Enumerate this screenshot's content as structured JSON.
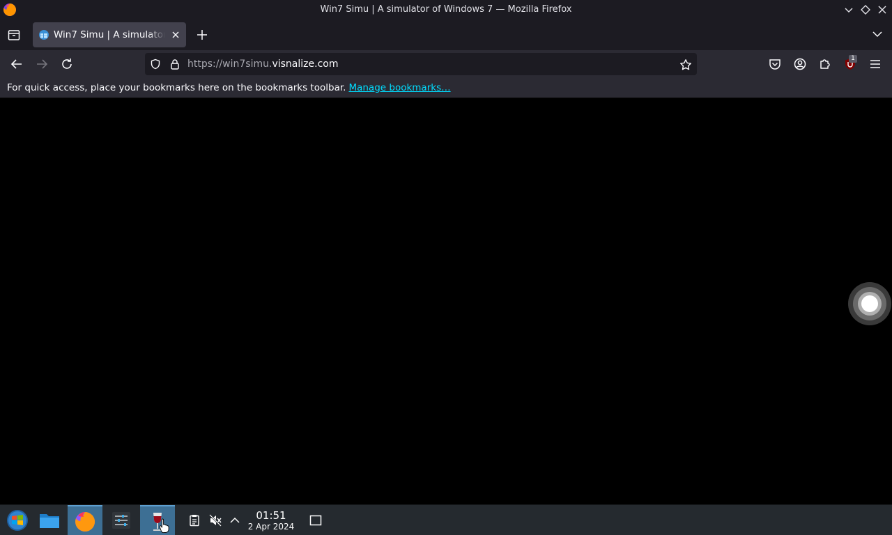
{
  "window": {
    "title": "Win7 Simu | A simulator of Windows 7 — Mozilla Firefox"
  },
  "tabs": [
    {
      "title": "Win7 Simu | A simulator of Windows 7",
      "active": true
    }
  ],
  "urlbar": {
    "scheme_prefix": "https://win7simu.",
    "domain": "visnalize.com"
  },
  "toolbar": {
    "extension_badge": "1"
  },
  "bookmarks_toolbar": {
    "message": "For quick access, place your bookmarks here on the bookmarks toolbar.",
    "manage_link": "Manage bookmarks…"
  },
  "taskbar": {
    "items": [
      {
        "name": "start-menu",
        "icon": "windows-orb-icon",
        "active": false
      },
      {
        "name": "file-manager",
        "icon": "folder-icon",
        "active": false
      },
      {
        "name": "firefox",
        "icon": "firefox-icon",
        "active": true
      },
      {
        "name": "settings",
        "icon": "sliders-icon",
        "active": false
      },
      {
        "name": "wine",
        "icon": "wine-glass-icon",
        "active": true
      }
    ],
    "clock": {
      "time": "01:51",
      "date": "2 Apr 2024"
    }
  },
  "colors": {
    "chrome_dark": "#1c1b22",
    "toolbar": "#2b2a33",
    "tab_active": "#42414d",
    "link": "#00ddff",
    "taskbar": "#252a2f",
    "taskbar_active": "#3d6f94"
  }
}
